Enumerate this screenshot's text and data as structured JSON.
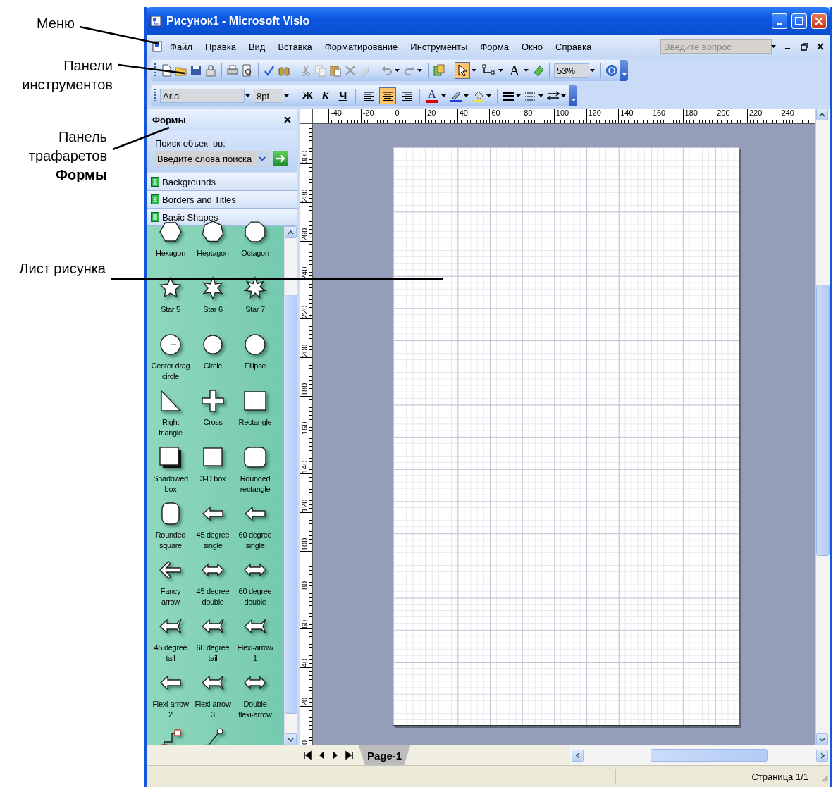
{
  "callouts": [
    {
      "text": "Меню"
    },
    {
      "text": "Панели инструментов"
    },
    {
      "text": "Панель трафаретов **Формы**"
    },
    {
      "text": "Лист рисунка"
    }
  ],
  "window": {
    "title": "Рисунок1 - Microsoft Visio"
  },
  "menu": {
    "items": [
      "Файл",
      "Правка",
      "Вид",
      "Вставка",
      "Форматирование",
      "Инструменты",
      "Форма",
      "Окно",
      "Справка"
    ],
    "help_placeholder": "Введите вопрос"
  },
  "toolbar_standard": {
    "tools": [
      {
        "kind": "pointer",
        "selected": true
      },
      {
        "kind": "connector",
        "selected": false
      },
      {
        "kind": "text",
        "label": "A",
        "selected": false
      }
    ],
    "zoom": "53%"
  },
  "toolbar_format": {
    "font": "Arial",
    "size": "8pt",
    "styles": [
      {
        "kind": "bold",
        "label": "Ж"
      },
      {
        "kind": "italic",
        "label": "К"
      },
      {
        "kind": "underline",
        "label": "Ч"
      }
    ],
    "align": [
      {
        "kind": "left",
        "selected": false
      },
      {
        "kind": "center",
        "selected": true
      },
      {
        "kind": "right",
        "selected": false
      }
    ],
    "font_color_label": "A"
  },
  "shapes_panel": {
    "title": "Формы",
    "search_label": "Поиск объек¯ов:",
    "search_placeholder": "Введите слова поиска",
    "stencils": [
      "Backgrounds",
      "Borders and Titles",
      "Basic Shapes"
    ],
    "shapes": [
      {
        "label": "Hexagon",
        "kind": "hexagon"
      },
      {
        "label": "Heptagon",
        "kind": "heptagon"
      },
      {
        "label": "Octagon",
        "kind": "octagon"
      },
      {
        "label": "Star 5",
        "kind": "star5"
      },
      {
        "label": "Star 6",
        "kind": "star6"
      },
      {
        "label": "Star 7",
        "kind": "star7"
      },
      {
        "label": "Center drag circle",
        "kind": "center-circle"
      },
      {
        "label": "Circle",
        "kind": "circle"
      },
      {
        "label": "Ellipse",
        "kind": "ellipse"
      },
      {
        "label": "Right triangle",
        "kind": "right-triangle"
      },
      {
        "label": "Cross",
        "kind": "cross"
      },
      {
        "label": "Rectangle",
        "kind": "rectangle"
      },
      {
        "label": "Shadowed box",
        "kind": "shadowed-box"
      },
      {
        "label": "3-D box",
        "kind": "box"
      },
      {
        "label": "Rounded rectangle",
        "kind": "rounded-rectangle"
      },
      {
        "label": "Rounded square",
        "kind": "rounded-square"
      },
      {
        "label": "45 degree single",
        "kind": "arrow"
      },
      {
        "label": "60 degree single",
        "kind": "arrow"
      },
      {
        "label": "Fancy arrow",
        "kind": "fancy-arrow"
      },
      {
        "label": "45 degree double",
        "kind": "double-arrow"
      },
      {
        "label": "60 degree double",
        "kind": "double-arrow"
      },
      {
        "label": "45 degree tail",
        "kind": "tail-arrow"
      },
      {
        "label": "60 degree tail",
        "kind": "tail-arrow"
      },
      {
        "label": "Flexi-arrow 1",
        "kind": "tail-arrow"
      },
      {
        "label": "Flexi-arrow 2",
        "kind": "arrow"
      },
      {
        "label": "Flexi-arrow 3",
        "kind": "tail-arrow"
      },
      {
        "label": "Double flexi-arrow",
        "kind": "double-arrow"
      },
      {
        "kind": "connector"
      },
      {
        "kind": "arc"
      }
    ]
  },
  "rulers": {
    "horizontal": [
      "-40",
      "-20",
      "0",
      "20",
      "40",
      "60",
      "80",
      "100",
      "120",
      "140",
      "160",
      "180",
      "200",
      "220",
      "240"
    ],
    "vertical": [
      "300",
      "280",
      "260",
      "240",
      "220",
      "200",
      "180",
      "160",
      "140",
      "120",
      "100",
      "80",
      "60",
      "40",
      "20",
      "0"
    ]
  },
  "page_tabs": [
    {
      "label": "Page-1",
      "selected": true
    }
  ],
  "status_bar": {
    "page": "Страница 1/1"
  }
}
